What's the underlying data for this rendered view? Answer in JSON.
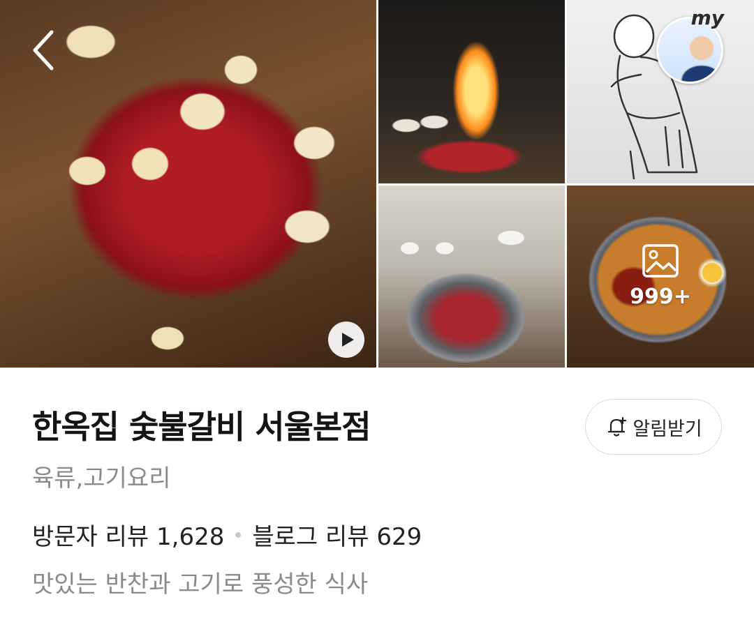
{
  "gallery": {
    "more_photos_count": "999+",
    "my_label": "my"
  },
  "place": {
    "name": "한옥집 숯불갈비 서울본점",
    "category": "육류,고기요리",
    "visitor_reviews_label": "방문자 리뷰 1,628",
    "blog_reviews_label": "블로그 리뷰 629",
    "description": "맛있는 반찬과 고기로 풍성한 식사"
  },
  "actions": {
    "notify_label": "알림받기"
  },
  "icons": {
    "back": "chevron-left-icon",
    "play": "play-icon",
    "image": "image-icon",
    "bell": "bell-plus-icon"
  }
}
